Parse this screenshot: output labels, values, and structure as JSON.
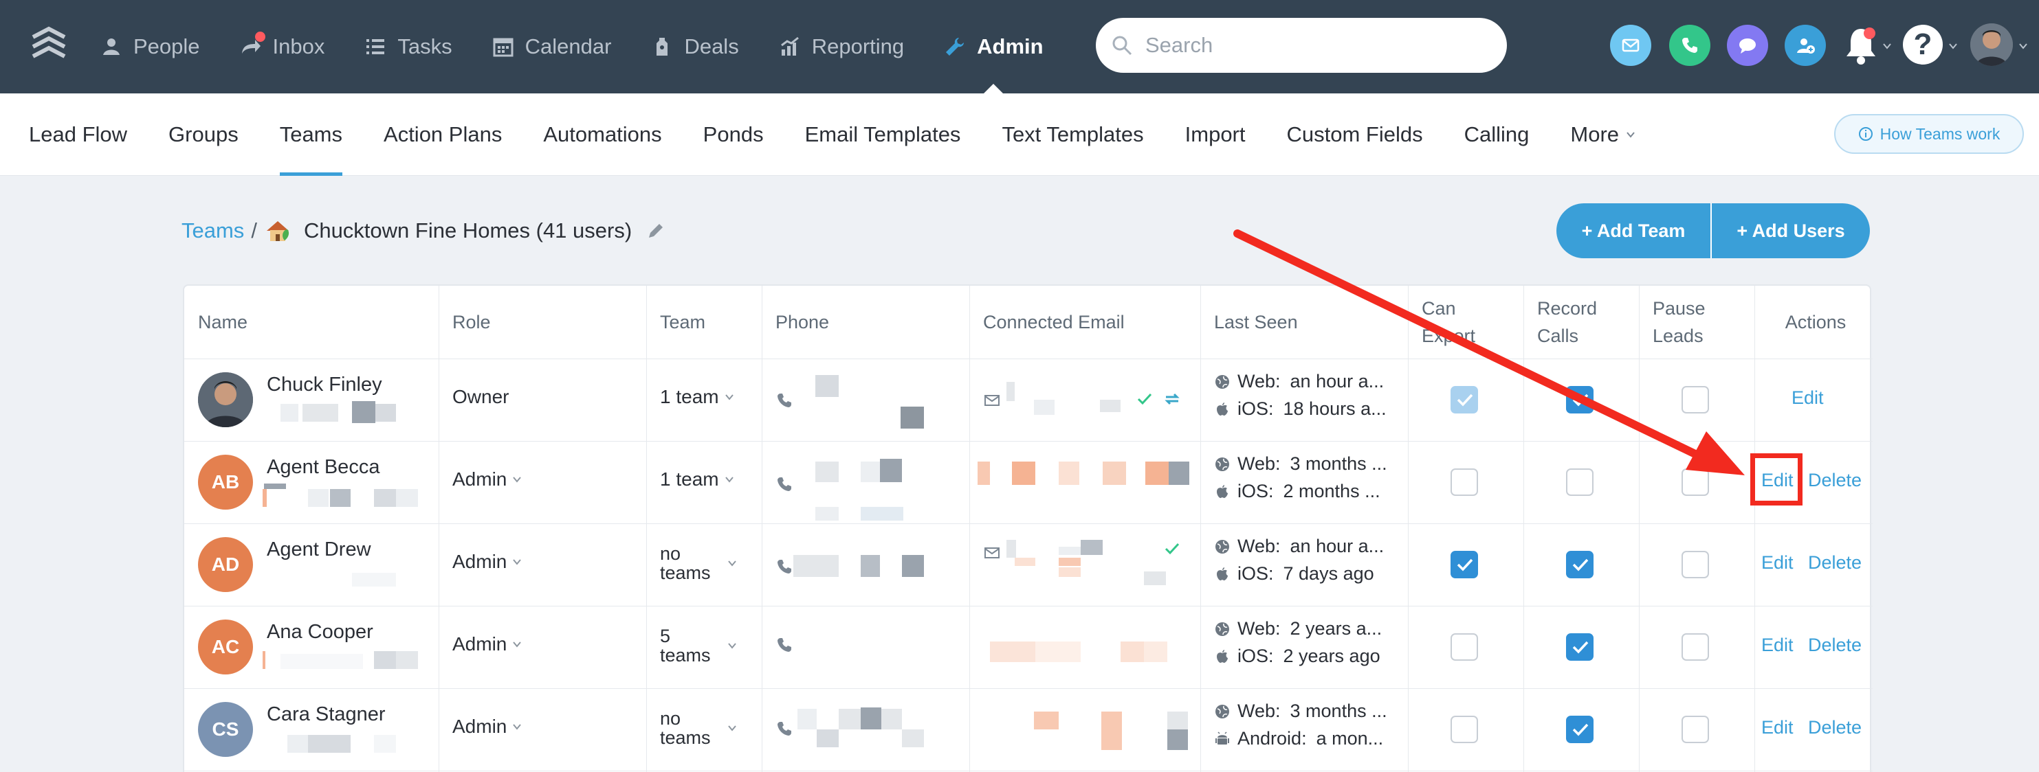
{
  "topnav": {
    "items": [
      {
        "label": "People",
        "icon": "people-icon"
      },
      {
        "label": "Inbox",
        "icon": "inbox-icon"
      },
      {
        "label": "Tasks",
        "icon": "tasks-icon"
      },
      {
        "label": "Calendar",
        "icon": "calendar-icon"
      },
      {
        "label": "Deals",
        "icon": "deals-icon"
      },
      {
        "label": "Reporting",
        "icon": "reporting-icon"
      },
      {
        "label": "Admin",
        "icon": "wrench-icon"
      }
    ],
    "active": "Admin",
    "search_placeholder": "Search"
  },
  "subnav": {
    "items": [
      "Lead Flow",
      "Groups",
      "Teams",
      "Action Plans",
      "Automations",
      "Ponds",
      "Email Templates",
      "Text Templates",
      "Import",
      "Custom Fields",
      "Calling",
      "More"
    ],
    "active": "Teams",
    "help_button": "How Teams work"
  },
  "breadcrumb": {
    "root": "Teams",
    "separator": "/",
    "title": "Chucktown Fine Homes (41 users)"
  },
  "buttons": {
    "add_team": "+ Add Team",
    "add_users": "+ Add Users"
  },
  "table": {
    "headers": {
      "name": "Name",
      "role": "Role",
      "team": "Team",
      "phone": "Phone",
      "email": "Connected Email",
      "last_seen": "Last Seen",
      "can_export_1": "Can",
      "can_export_2": "Export",
      "record_1": "Record",
      "record_2": "Calls",
      "pause_1": "Pause",
      "pause_2": "Leads",
      "actions": "Actions"
    },
    "rows": [
      {
        "initials": "",
        "name": "Chuck Finley",
        "role": "Owner",
        "team": "1 team",
        "web_label": "Web:",
        "web": "an hour a...",
        "app_label": "iOS:",
        "app": "18 hours a...",
        "can_export": true,
        "record_calls": true,
        "pause_leads": false,
        "edit": "Edit",
        "delete": ""
      },
      {
        "initials": "AB",
        "name": "Agent Becca",
        "role": "Admin",
        "team": "1 team",
        "web_label": "Web:",
        "web": "3 months ...",
        "app_label": "iOS:",
        "app": "2 months ...",
        "can_export": false,
        "record_calls": false,
        "pause_leads": false,
        "edit": "Edit",
        "delete": "Delete"
      },
      {
        "initials": "AD",
        "name": "Agent Drew",
        "role": "Admin",
        "team": "no teams",
        "web_label": "Web:",
        "web": "an hour a...",
        "app_label": "iOS:",
        "app": "7 days ago",
        "can_export": true,
        "record_calls": true,
        "pause_leads": false,
        "edit": "Edit",
        "delete": "Delete"
      },
      {
        "initials": "AC",
        "name": "Ana Cooper",
        "role": "Admin",
        "team": "5 teams",
        "web_label": "Web:",
        "web": "2 years a...",
        "app_label": "iOS:",
        "app": "2 years ago",
        "can_export": false,
        "record_calls": true,
        "pause_leads": false,
        "edit": "Edit",
        "delete": "Delete"
      },
      {
        "initials": "CS",
        "name": "Cara Stagner",
        "role": "Admin",
        "team": "no teams",
        "web_label": "Web:",
        "web": "3 months ...",
        "app_label": "Android:",
        "app": "a mon...",
        "can_export": false,
        "record_calls": true,
        "pause_leads": false,
        "edit": "Edit",
        "delete": "Delete"
      }
    ]
  },
  "colors": {
    "topbar": "#344453",
    "accent": "#3a9fd8",
    "avatar_orange": "#e4804f",
    "avatar_slate": "#7b93b2",
    "annotation": "#f22a1f"
  }
}
